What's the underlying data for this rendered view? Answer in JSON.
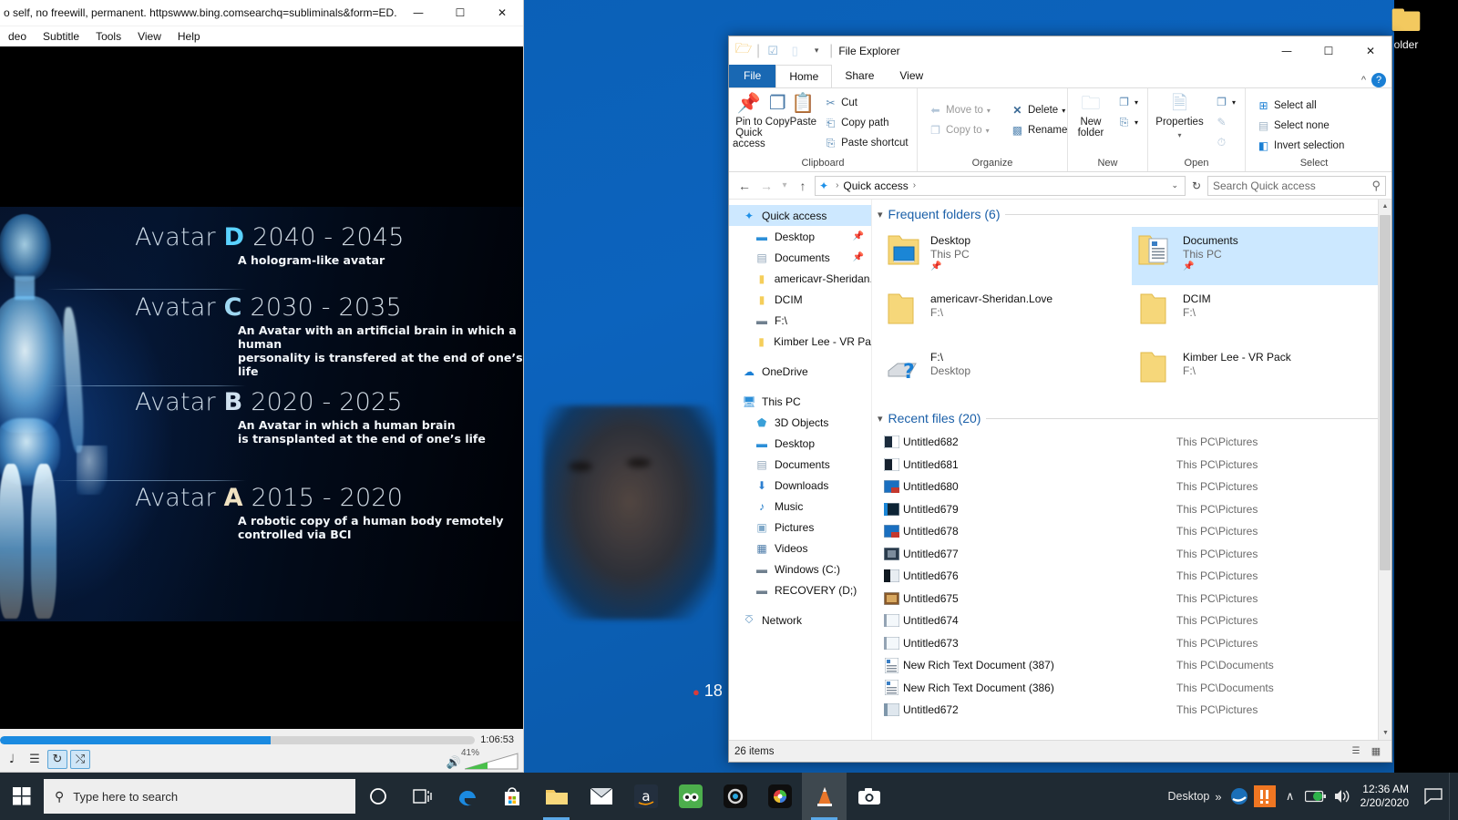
{
  "desktop": {
    "icon_label": "older",
    "icon_name": "folder-icon"
  },
  "player": {
    "title": "o self, no freewill, permanent. httpswww.bing.comsearchq=subliminals&form=ED...",
    "window_buttons": {
      "minimize": "—",
      "maximize": "☐",
      "close": "✕"
    },
    "menu": [
      "deo",
      "Subtitle",
      "Tools",
      "View",
      "Help"
    ],
    "seek": {
      "progress_pct": 57,
      "time": "1:06:53"
    },
    "controls": [
      {
        "name": "equalizer-button",
        "glyph": "♩",
        "active": false
      },
      {
        "name": "playlist-button",
        "glyph": "☰",
        "active": false
      },
      {
        "name": "loop-button",
        "glyph": "↻",
        "active": true
      },
      {
        "name": "shuffle-button",
        "glyph": "⤭",
        "active": true
      }
    ],
    "volume": {
      "percent": "41%",
      "level": 41,
      "mute_icon": "speaker-icon"
    },
    "video": {
      "rows": [
        {
          "label": "Avatar",
          "letter": "D",
          "letter_color": "#5ad2ff",
          "years": "2040 - 2045",
          "desc": "A hologram-like avatar"
        },
        {
          "label": "Avatar",
          "letter": "C",
          "letter_color": "#9fd8f2",
          "years": "2030 - 2035",
          "desc": "An Avatar with an artificial brain in which a human\npersonality  is transfered at the end of one’s life"
        },
        {
          "label": "Avatar",
          "letter": "B",
          "letter_color": "#cfe0ee",
          "years": "2020 - 2025",
          "desc": "An Avatar in which a human brain\nis transplanted at the end of one’s life"
        },
        {
          "label": "Avatar",
          "letter": "A",
          "letter_color": "#f0e2c2",
          "years": "2015 - 2020",
          "desc": "A robotic copy of a human body remotely\ncontrolled via BCI"
        }
      ]
    }
  },
  "explorer": {
    "title": "File Explorer",
    "window_buttons": {
      "minimize": "—",
      "maximize": "☐",
      "close": "✕"
    },
    "quick_access_toolbar": [
      {
        "name": "explorer-app-icon",
        "glyph": "🗁"
      },
      {
        "name": "properties-qat-icon",
        "glyph": "☑"
      },
      {
        "name": "new-folder-qat-icon",
        "glyph": "▭"
      },
      {
        "name": "customize-qat-chevron-icon",
        "glyph": "▾"
      }
    ],
    "tabs": [
      {
        "label": "File",
        "kind": "file"
      },
      {
        "label": "Home",
        "kind": "active"
      },
      {
        "label": "Share",
        "kind": "normal"
      },
      {
        "label": "View",
        "kind": "normal"
      }
    ],
    "ribbon_collapse_icon": "^",
    "ribbon_help_icon": "?",
    "ribbon": {
      "groups": [
        {
          "label": "Clipboard",
          "big": [
            {
              "label": "Pin to Quick\naccess",
              "icon": "pin-icon",
              "glyph": "📌"
            },
            {
              "label": "Copy",
              "icon": "copy-icon",
              "glyph": "❐"
            },
            {
              "label": "Paste",
              "icon": "paste-icon",
              "glyph": "📋"
            }
          ],
          "small": [
            {
              "label": "Cut",
              "icon": "cut-icon",
              "glyph": "✂",
              "dim": false
            },
            {
              "label": "Copy path",
              "icon": "copy-path-icon",
              "glyph": "⎗",
              "dim": false
            },
            {
              "label": "Paste shortcut",
              "icon": "paste-shortcut-icon",
              "glyph": "⎘",
              "dim": false
            }
          ]
        },
        {
          "label": "Organize",
          "big": [],
          "small": [
            {
              "label": "Move to",
              "icon": "move-to-icon",
              "glyph": "⬅",
              "dim": true,
              "caret": true
            },
            {
              "label": "Copy to",
              "icon": "copy-to-icon",
              "glyph": "❐",
              "dim": true,
              "caret": true
            }
          ],
          "small2": [
            {
              "label": "Delete",
              "icon": "delete-icon",
              "glyph": "✕",
              "dim": false,
              "caret": true
            },
            {
              "label": "Rename",
              "icon": "rename-icon",
              "glyph": "⬚",
              "dim": false,
              "caret": false
            }
          ]
        },
        {
          "label": "New",
          "big": [
            {
              "label": "New\nfolder",
              "icon": "new-folder-icon",
              "glyph": "🗀"
            }
          ],
          "small": [
            {
              "label": "",
              "icon": "new-item-icon",
              "glyph": "❐",
              "dim": false,
              "caret": true
            },
            {
              "label": "",
              "icon": "easy-access-icon",
              "glyph": "⎘",
              "dim": false,
              "caret": true
            }
          ]
        },
        {
          "label": "Open",
          "big": [
            {
              "label": "Properties",
              "icon": "properties-icon",
              "glyph": "🗎"
            }
          ],
          "small": [
            {
              "label": "",
              "icon": "open-with-icon",
              "glyph": "❐",
              "dim": false,
              "caret": true
            },
            {
              "label": "",
              "icon": "edit-icon",
              "glyph": "✎",
              "dim": true,
              "caret": false
            },
            {
              "label": "",
              "icon": "history-icon",
              "glyph": "⏱",
              "dim": true,
              "caret": false
            }
          ]
        },
        {
          "label": "Select",
          "big": [],
          "small": [
            {
              "label": "Select all",
              "icon": "select-all-icon",
              "glyph": "⊞",
              "dim": false
            },
            {
              "label": "Select none",
              "icon": "select-none-icon",
              "glyph": "⬚",
              "dim": false
            },
            {
              "label": "Invert selection",
              "icon": "invert-selection-icon",
              "glyph": "◧",
              "dim": false
            }
          ]
        }
      ]
    },
    "address": {
      "back_icon": "←",
      "forward_icon": "→",
      "recent_icon": "▾",
      "up_icon": "↑",
      "crumb_star_icon": "star-icon",
      "crumb": "Quick access",
      "crumb_sep": "›",
      "dropdown_icon": "⌄",
      "refresh_icon": "↻",
      "search_placeholder": "Search Quick access",
      "search_icon": "⚲"
    },
    "navpane": [
      {
        "label": "Quick access",
        "icon": "quick-access-star-icon",
        "glyph": "★",
        "color": "#1e90e8",
        "level": 1,
        "selected": true,
        "pin": false
      },
      {
        "label": "Desktop",
        "icon": "desktop-icon",
        "glyph": "▬",
        "color": "#2c8fd8",
        "level": 2,
        "selected": false,
        "pin": true
      },
      {
        "label": "Documents",
        "icon": "documents-icon",
        "glyph": "▤",
        "color": "#8fa4b8",
        "level": 2,
        "selected": false,
        "pin": true
      },
      {
        "label": "americavr-Sheridan.",
        "icon": "folder-icon",
        "glyph": "▮",
        "color": "#f5ce5a",
        "level": 2,
        "selected": false,
        "pin": false
      },
      {
        "label": "DCIM",
        "icon": "folder-icon",
        "glyph": "▮",
        "color": "#f5ce5a",
        "level": 2,
        "selected": false,
        "pin": false
      },
      {
        "label": "F:\\",
        "icon": "removable-drive-icon",
        "glyph": "▬",
        "color": "#70808f",
        "level": 2,
        "selected": false,
        "pin": false
      },
      {
        "label": "Kimber Lee - VR Pac",
        "icon": "folder-icon",
        "glyph": "▮",
        "color": "#f5ce5a",
        "level": 2,
        "selected": false,
        "pin": false
      },
      {
        "label": "OneDrive",
        "icon": "onedrive-cloud-icon",
        "glyph": "☁",
        "color": "#1a7fd4",
        "level": 1,
        "selected": false,
        "pin": false
      },
      {
        "label": "This PC",
        "icon": "this-pc-icon",
        "glyph": "🖥",
        "color": "#2c8fd8",
        "level": 1,
        "selected": false,
        "pin": false
      },
      {
        "label": "3D Objects",
        "icon": "3d-objects-icon",
        "glyph": "⬟",
        "color": "#3aa0d8",
        "level": 2,
        "selected": false,
        "pin": false
      },
      {
        "label": "Desktop",
        "icon": "desktop-icon",
        "glyph": "▬",
        "color": "#2c8fd8",
        "level": 2,
        "selected": false,
        "pin": false
      },
      {
        "label": "Documents",
        "icon": "documents-icon",
        "glyph": "▤",
        "color": "#8fa4b8",
        "level": 2,
        "selected": false,
        "pin": false
      },
      {
        "label": "Downloads",
        "icon": "downloads-icon",
        "glyph": "⬇",
        "color": "#2c7fd0",
        "level": 2,
        "selected": false,
        "pin": false
      },
      {
        "label": "Music",
        "icon": "music-icon",
        "glyph": "♪",
        "color": "#1a78c8",
        "level": 2,
        "selected": false,
        "pin": false
      },
      {
        "label": "Pictures",
        "icon": "pictures-icon",
        "glyph": "▣",
        "color": "#7fa8c8",
        "level": 2,
        "selected": false,
        "pin": false
      },
      {
        "label": "Videos",
        "icon": "videos-icon",
        "glyph": "▦",
        "color": "#4a7aa8",
        "level": 2,
        "selected": false,
        "pin": false
      },
      {
        "label": "Windows (C:)",
        "icon": "windows-drive-icon",
        "glyph": "▬",
        "color": "#70808f",
        "level": 2,
        "selected": false,
        "pin": false
      },
      {
        "label": "RECOVERY (D;)",
        "icon": "drive-icon",
        "glyph": "▬",
        "color": "#70808f",
        "level": 2,
        "selected": false,
        "pin": false
      },
      {
        "label": "Network",
        "icon": "network-icon",
        "glyph": "⌗",
        "color": "#4a86b8",
        "level": 1,
        "selected": false,
        "pin": false
      }
    ],
    "frequent_folders": {
      "heading": "Frequent folders (6)",
      "items": [
        {
          "name": "Desktop",
          "sub": "This PC",
          "pinned": true,
          "selected": false,
          "icon": "desktop-folder-icon"
        },
        {
          "name": "Documents",
          "sub": "This PC",
          "pinned": true,
          "selected": true,
          "icon": "documents-folder-icon"
        },
        {
          "name": "americavr-Sheridan.Love",
          "sub": "F:\\",
          "pinned": false,
          "selected": false,
          "icon": "folder-icon"
        },
        {
          "name": "DCIM",
          "sub": "F:\\",
          "pinned": false,
          "selected": false,
          "icon": "folder-icon"
        },
        {
          "name": "F:\\",
          "sub": "Desktop",
          "pinned": false,
          "selected": false,
          "icon": "removable-drive-icon"
        },
        {
          "name": "Kimber Lee - VR Pack",
          "sub": "F:\\",
          "pinned": false,
          "selected": false,
          "icon": "folder-icon"
        }
      ]
    },
    "recent_files": {
      "heading": "Recent files (20)",
      "items": [
        {
          "name": "Untitled682",
          "path": "This PC\\Pictures",
          "icon": "image-thumb-icon",
          "thumb": "#1b2b3c"
        },
        {
          "name": "Untitled681",
          "path": "This PC\\Pictures",
          "icon": "image-thumb-icon",
          "thumb": "#16212e"
        },
        {
          "name": "Untitled680",
          "path": "This PC\\Pictures",
          "icon": "image-thumb-icon",
          "thumb": "#1a6fc0"
        },
        {
          "name": "Untitled679",
          "path": "This PC\\Pictures",
          "icon": "image-thumb-icon",
          "thumb": "#0d2435"
        },
        {
          "name": "Untitled678",
          "path": "This PC\\Pictures",
          "icon": "image-thumb-icon",
          "thumb": "#1a6fc0"
        },
        {
          "name": "Untitled677",
          "path": "This PC\\Pictures",
          "icon": "image-thumb-icon",
          "thumb": "#2a3b4c"
        },
        {
          "name": "Untitled676",
          "path": "This PC\\Pictures",
          "icon": "image-thumb-icon",
          "thumb": "#101820"
        },
        {
          "name": "Untitled675",
          "path": "This PC\\Pictures",
          "icon": "image-thumb-icon",
          "thumb": "#8a5a2a"
        },
        {
          "name": "Untitled674",
          "path": "This PC\\Pictures",
          "icon": "image-thumb-icon",
          "thumb": "#e8edf2"
        },
        {
          "name": "Untitled673",
          "path": "This PC\\Pictures",
          "icon": "image-thumb-icon",
          "thumb": "#e8edf2"
        },
        {
          "name": "New Rich Text Document (387)",
          "path": "This PC\\Documents",
          "icon": "rtf-document-icon",
          "thumb": "#ffffff"
        },
        {
          "name": "New Rich Text Document (386)",
          "path": "This PC\\Documents",
          "icon": "rtf-document-icon",
          "thumb": "#ffffff"
        },
        {
          "name": "Untitled672",
          "path": "This PC\\Pictures",
          "icon": "image-thumb-icon",
          "thumb": "#dfe7ee"
        }
      ]
    },
    "status": {
      "items_count": "26 items"
    },
    "view_buttons": [
      {
        "name": "details-view-button",
        "glyph": "☰",
        "active": false
      },
      {
        "name": "large-icons-view-button",
        "glyph": "▦",
        "active": false
      }
    ]
  },
  "taskbar": {
    "start_icon": "windows-logo-icon",
    "search_placeholder": "Type here to search",
    "search_icon": "search-icon",
    "pinned": [
      {
        "name": "cortana-icon",
        "glyph": "◯",
        "running": false,
        "active": false
      },
      {
        "name": "task-view-icon",
        "glyph": "⧉",
        "running": false,
        "active": false
      },
      {
        "name": "microsoft-edge-icon",
        "glyph": "e",
        "running": false,
        "active": false
      },
      {
        "name": "microsoft-store-icon",
        "glyph": "🛍",
        "running": false,
        "active": false
      },
      {
        "name": "file-explorer-icon",
        "glyph": "🗁",
        "running": true,
        "active": false
      },
      {
        "name": "mail-icon",
        "glyph": "✉",
        "running": false,
        "active": false
      },
      {
        "name": "amazon-icon",
        "glyph": "a",
        "running": false,
        "active": false
      },
      {
        "name": "tripadvisor-icon",
        "glyph": "◉",
        "running": false,
        "active": false
      },
      {
        "name": "camera-app-icon",
        "glyph": "◎",
        "running": false,
        "active": false
      },
      {
        "name": "color-app-icon",
        "glyph": "◉",
        "running": false,
        "active": false
      },
      {
        "name": "vlc-media-player-icon",
        "glyph": "▲",
        "running": true,
        "active": true
      },
      {
        "name": "snipping-tool-icon",
        "glyph": "📷",
        "running": false,
        "active": false
      }
    ],
    "tray": {
      "desktop_label": "Desktop",
      "overflow_icon": "»",
      "apps": [
        {
          "name": "ie-tray-icon",
          "glyph": "e"
        },
        {
          "name": "warning-tray-icon",
          "glyph": "!!"
        }
      ],
      "chevron_icon": "∧",
      "battery_icon": "🔋",
      "volume_icon": "🔊",
      "time": "12:36 AM",
      "date": "2/20/2020",
      "action_center_icon": "▭"
    }
  }
}
